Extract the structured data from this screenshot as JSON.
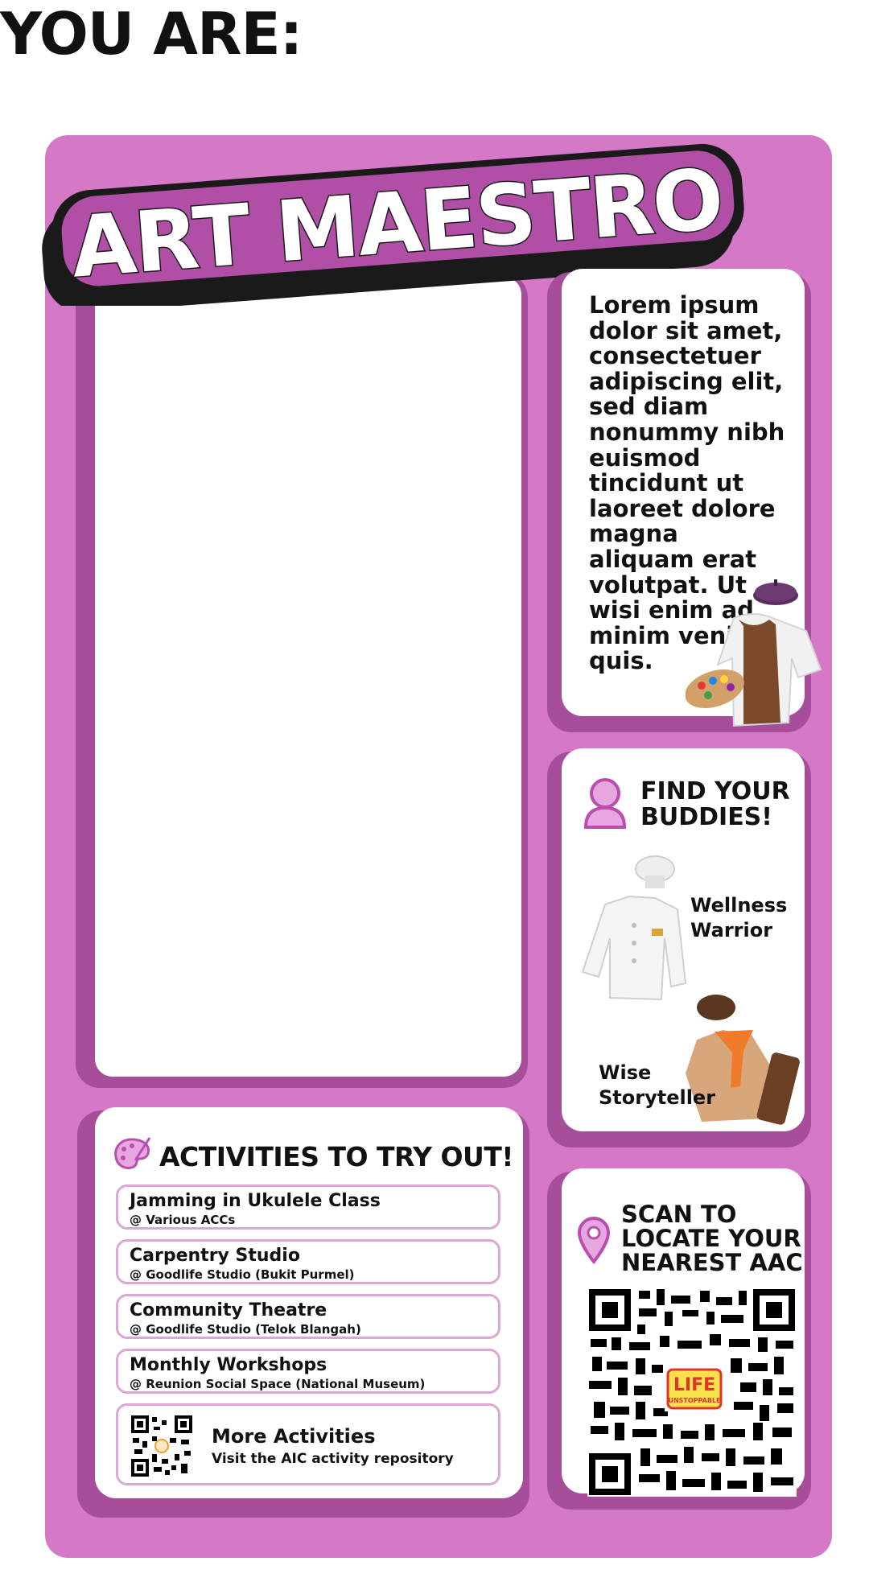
{
  "page_heading": "YOU ARE:",
  "banner_title": "ART MAESTRO",
  "description": "Lorem ipsum dolor sit amet, consectetuer adipiscing elit, sed diam nonummy nibh euismod tincidunt ut laoreet dolore magna aliquam erat volutpat. Ut wisi enim ad minim veniam quis.",
  "buddies": {
    "title_line1": "FIND YOUR",
    "title_line2": "BUDDIES!",
    "buddy1_line1": "Wellness",
    "buddy1_line2": "Warrior",
    "buddy2_line1": "Wise",
    "buddy2_line2": "Storyteller"
  },
  "activities": {
    "title": "ACTIVITIES TO TRY OUT!",
    "items": [
      {
        "name": "Jamming in Ukulele Class",
        "location": "@ Various ACCs"
      },
      {
        "name": "Carpentry Studio",
        "location": "@ Goodlife Studio (Bukit Purmel)"
      },
      {
        "name": "Community Theatre",
        "location": "@ Goodlife Studio (Telok Blangah)"
      },
      {
        "name": "Monthly Workshops",
        "location": "@ Reunion Social Space (National Museum)"
      }
    ],
    "more_title": "More Activities",
    "more_sub": "Visit the AIC activity repository"
  },
  "scan": {
    "line1": "SCAN TO",
    "line2": "LOCATE YOUR",
    "line3": "NEAREST AAC",
    "qr_logo_line1": "LIFE",
    "qr_logo_line2": "UNSTOPPABLE"
  },
  "colors": {
    "frame": "#d678c8",
    "shadow": "#a64e9c",
    "banner_fill": "#b04fa5",
    "banner_outline": "#1a1a1a",
    "row_border": "#dca6d6",
    "accent": "#c75bbd"
  },
  "icons": [
    "beret-hat-icon",
    "artist-smock-palette-icon",
    "person-icon",
    "chef-jacket-icon",
    "chef-hat-icon",
    "storyteller-jacket-icon",
    "paint-palette-icon",
    "location-pin-icon",
    "qr-code-icon"
  ]
}
